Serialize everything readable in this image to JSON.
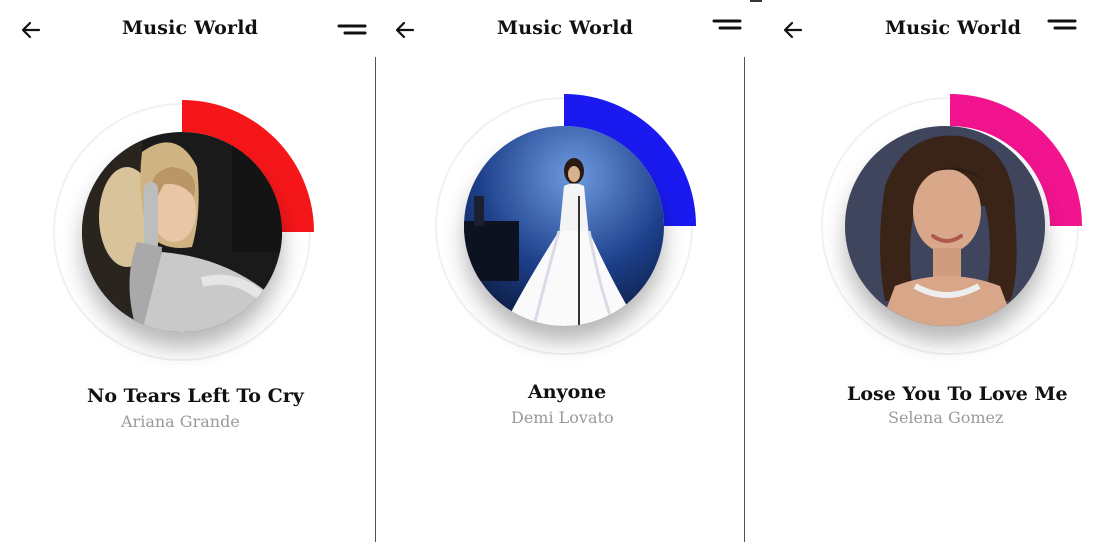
{
  "app": {
    "title": "Music World"
  },
  "icons": {
    "back": "left-arrow",
    "menu": "two-line-menu"
  },
  "screens": [
    {
      "song_title": "No Tears Left To Cry",
      "artist": "Ariana Grande",
      "progress": 0.25,
      "accent_color": "#f5161a",
      "cover": "photo of Ariana Grande in grey gloves"
    },
    {
      "song_title": "Anyone",
      "artist": "Demi Lovato",
      "progress": 0.25,
      "accent_color": "#1a1af0",
      "cover": "photo of Demi Lovato in white gown on stage"
    },
    {
      "song_title": "Lose You To Love Me",
      "artist": "Selena Gomez",
      "progress": 0.25,
      "accent_color": "#f2138f",
      "cover": "photo of Selena Gomez with shoulder-length hair"
    }
  ]
}
